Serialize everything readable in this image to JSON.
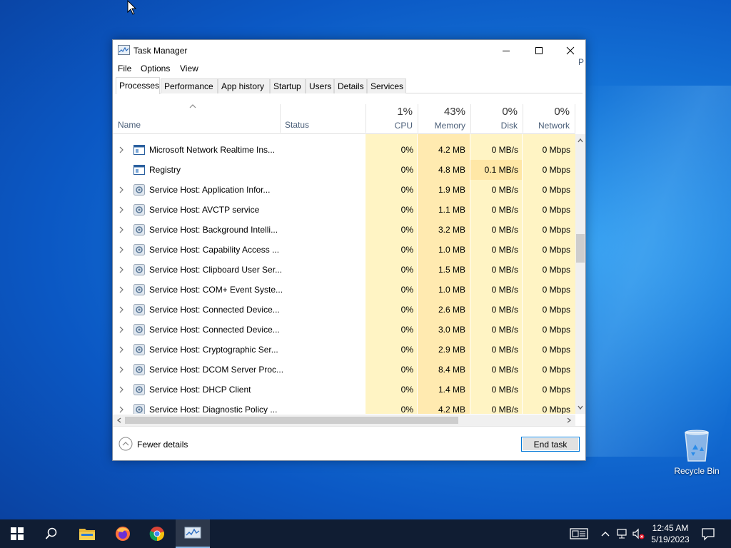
{
  "window": {
    "title": "Task Manager",
    "menu": [
      "File",
      "Options",
      "View"
    ],
    "tabs": [
      "Processes",
      "Performance",
      "App history",
      "Startup",
      "Users",
      "Details",
      "Services"
    ],
    "active_tab": "Processes"
  },
  "columns": {
    "name": "Name",
    "status": "Status",
    "cpu": {
      "pct": "1%",
      "label": "CPU"
    },
    "memory": {
      "pct": "43%",
      "label": "Memory"
    },
    "disk": {
      "pct": "0%",
      "label": "Disk"
    },
    "network": {
      "pct": "0%",
      "label": "Network"
    },
    "power_partial": "P"
  },
  "processes": [
    {
      "name": "Microsoft Network Realtime Ins...",
      "expandable": true,
      "icon": "window-icon",
      "cpu": "0%",
      "memory": "4.2 MB",
      "disk": "0 MB/s",
      "network": "0 Mbps"
    },
    {
      "name": "Registry",
      "expandable": false,
      "icon": "window-icon",
      "cpu": "0%",
      "memory": "4.8 MB",
      "disk": "0.1 MB/s",
      "network": "0 Mbps"
    },
    {
      "name": "Service Host: Application Infor...",
      "expandable": true,
      "icon": "gear-icon",
      "cpu": "0%",
      "memory": "1.9 MB",
      "disk": "0 MB/s",
      "network": "0 Mbps"
    },
    {
      "name": "Service Host: AVCTP service",
      "expandable": true,
      "icon": "gear-icon",
      "cpu": "0%",
      "memory": "1.1 MB",
      "disk": "0 MB/s",
      "network": "0 Mbps"
    },
    {
      "name": "Service Host: Background Intelli...",
      "expandable": true,
      "icon": "gear-icon",
      "cpu": "0%",
      "memory": "3.2 MB",
      "disk": "0 MB/s",
      "network": "0 Mbps"
    },
    {
      "name": "Service Host: Capability Access ...",
      "expandable": true,
      "icon": "gear-icon",
      "cpu": "0%",
      "memory": "1.0 MB",
      "disk": "0 MB/s",
      "network": "0 Mbps"
    },
    {
      "name": "Service Host: Clipboard User Ser...",
      "expandable": true,
      "icon": "gear-icon",
      "cpu": "0%",
      "memory": "1.5 MB",
      "disk": "0 MB/s",
      "network": "0 Mbps"
    },
    {
      "name": "Service Host: COM+ Event Syste...",
      "expandable": true,
      "icon": "gear-icon",
      "cpu": "0%",
      "memory": "1.0 MB",
      "disk": "0 MB/s",
      "network": "0 Mbps"
    },
    {
      "name": "Service Host: Connected Device...",
      "expandable": true,
      "icon": "gear-icon",
      "cpu": "0%",
      "memory": "2.6 MB",
      "disk": "0 MB/s",
      "network": "0 Mbps"
    },
    {
      "name": "Service Host: Connected Device...",
      "expandable": true,
      "icon": "gear-icon",
      "cpu": "0%",
      "memory": "3.0 MB",
      "disk": "0 MB/s",
      "network": "0 Mbps"
    },
    {
      "name": "Service Host: Cryptographic Ser...",
      "expandable": true,
      "icon": "gear-icon",
      "cpu": "0%",
      "memory": "2.9 MB",
      "disk": "0 MB/s",
      "network": "0 Mbps"
    },
    {
      "name": "Service Host: DCOM Server Proc...",
      "expandable": true,
      "icon": "gear-icon",
      "cpu": "0%",
      "memory": "8.4 MB",
      "disk": "0 MB/s",
      "network": "0 Mbps"
    },
    {
      "name": "Service Host: DHCP Client",
      "expandable": true,
      "icon": "gear-icon",
      "cpu": "0%",
      "memory": "1.4 MB",
      "disk": "0 MB/s",
      "network": "0 Mbps"
    },
    {
      "name": "Service Host: Diagnostic Policy ...",
      "expandable": true,
      "icon": "gear-icon",
      "cpu": "0%",
      "memory": "4.2 MB",
      "disk": "0 MB/s",
      "network": "0 Mbps"
    }
  ],
  "footer": {
    "fewer_details": "Fewer details",
    "end_task": "End task"
  },
  "desktop": {
    "recycle_bin": "Recycle Bin"
  },
  "taskbar": {
    "apps": [
      "start-icon",
      "search-icon",
      "file-explorer-icon",
      "firefox-icon",
      "chrome-icon",
      "task-manager-icon"
    ],
    "time": "12:45 AM",
    "date": "5/19/2023"
  },
  "colors": {
    "cpu_bg": "#fff4c4",
    "memory_bg": "#ffeab0",
    "disk_hot_bg": "#ffe7a6",
    "accent": "#0078d7",
    "taskbar": "#101d33"
  }
}
